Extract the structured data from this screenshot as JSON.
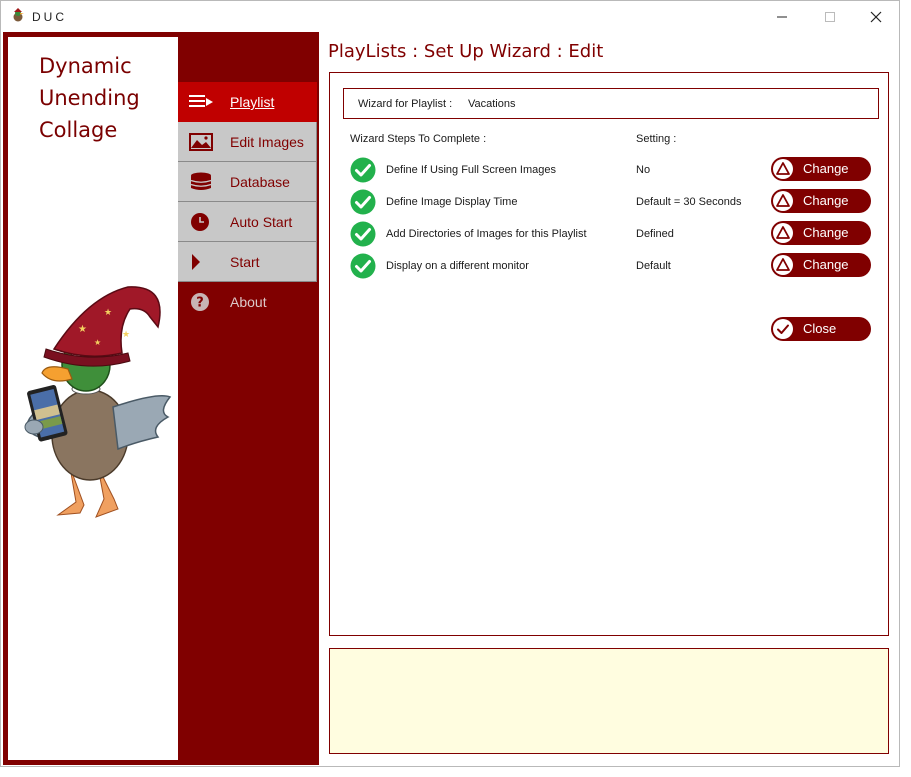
{
  "window": {
    "title": "DUC"
  },
  "brand": {
    "line1": "Dynamic",
    "line2": "Unending",
    "line3": "Collage"
  },
  "nav": {
    "items": [
      {
        "label": "Playlist",
        "icon": "playlist-icon",
        "state": "active"
      },
      {
        "label": "Edit Images",
        "icon": "image-icon",
        "state": "normal"
      },
      {
        "label": "Database",
        "icon": "database-icon",
        "state": "normal"
      },
      {
        "label": "Auto Start",
        "icon": "clock-icon",
        "state": "normal"
      },
      {
        "label": "Start",
        "icon": "play-icon",
        "state": "normal"
      },
      {
        "label": "About",
        "icon": "help-icon",
        "state": "plain"
      }
    ]
  },
  "main": {
    "page_title": "PlayLists : Set Up Wizard : Edit",
    "playlist_label": "Wizard for Playlist :",
    "playlist_name": "Vacations",
    "steps_header": "Wizard Steps To Complete :",
    "setting_header": "Setting :",
    "steps": [
      {
        "label": "Define If Using Full Screen Images",
        "value": "No",
        "button": "Change",
        "done": true
      },
      {
        "label": "Define Image Display Time",
        "value": "Default = 30 Seconds",
        "button": "Change",
        "done": true
      },
      {
        "label": "Add Directories of Images for this Playlist",
        "value": "Defined",
        "button": "Change",
        "done": true
      },
      {
        "label": "Display on a different monitor",
        "value": "Default",
        "button": "Change",
        "done": true
      }
    ],
    "close_label": "Close"
  },
  "colors": {
    "brand": "#800000",
    "active_nav": "#c00000",
    "nav_grey": "#c8c8c8",
    "check_green": "#22b14c",
    "notes_bg": "#fffde0"
  }
}
